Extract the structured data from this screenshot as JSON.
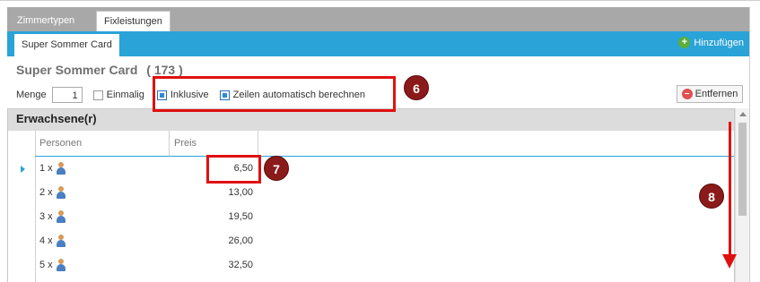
{
  "tabs": {
    "inactive_label": "Zimmertypen",
    "active_label": "Fixleistungen"
  },
  "subtab": {
    "label": "Super Sommer Card"
  },
  "add_button": {
    "label": "Hinzufügen",
    "icon": "plus-circle-icon"
  },
  "title": {
    "name": "Super Sommer Card",
    "count": "( 173 )"
  },
  "options": {
    "menge_label": "Menge",
    "menge_value": "1",
    "einmalig_label": "Einmalig",
    "inklusive_label": "Inklusive",
    "zeilen_label": "Zeilen automatisch berechnen",
    "einmalig_checked": false,
    "inklusive_checked": true,
    "zeilen_checked": true
  },
  "remove_button": {
    "label": "Entfernen",
    "icon": "minus-circle-icon"
  },
  "grid": {
    "group_header": "Erwachsene(r)",
    "columns": {
      "persons": "Personen",
      "price": "Preis"
    },
    "rows": [
      {
        "persons": "1 x",
        "price": "6,50"
      },
      {
        "persons": "2 x",
        "price": "13,00"
      },
      {
        "persons": "3 x",
        "price": "19,50"
      },
      {
        "persons": "4 x",
        "price": "26,00"
      },
      {
        "persons": "5 x",
        "price": "32,50"
      }
    ]
  },
  "annotations": {
    "badge_6": "6",
    "badge_7": "7",
    "badge_8": "8"
  },
  "colors": {
    "accent_blue": "#2aa3d8",
    "callout_red": "#e01010",
    "badge_dark_red": "#8b1a1a",
    "tab_gray": "#a8a8a8"
  }
}
